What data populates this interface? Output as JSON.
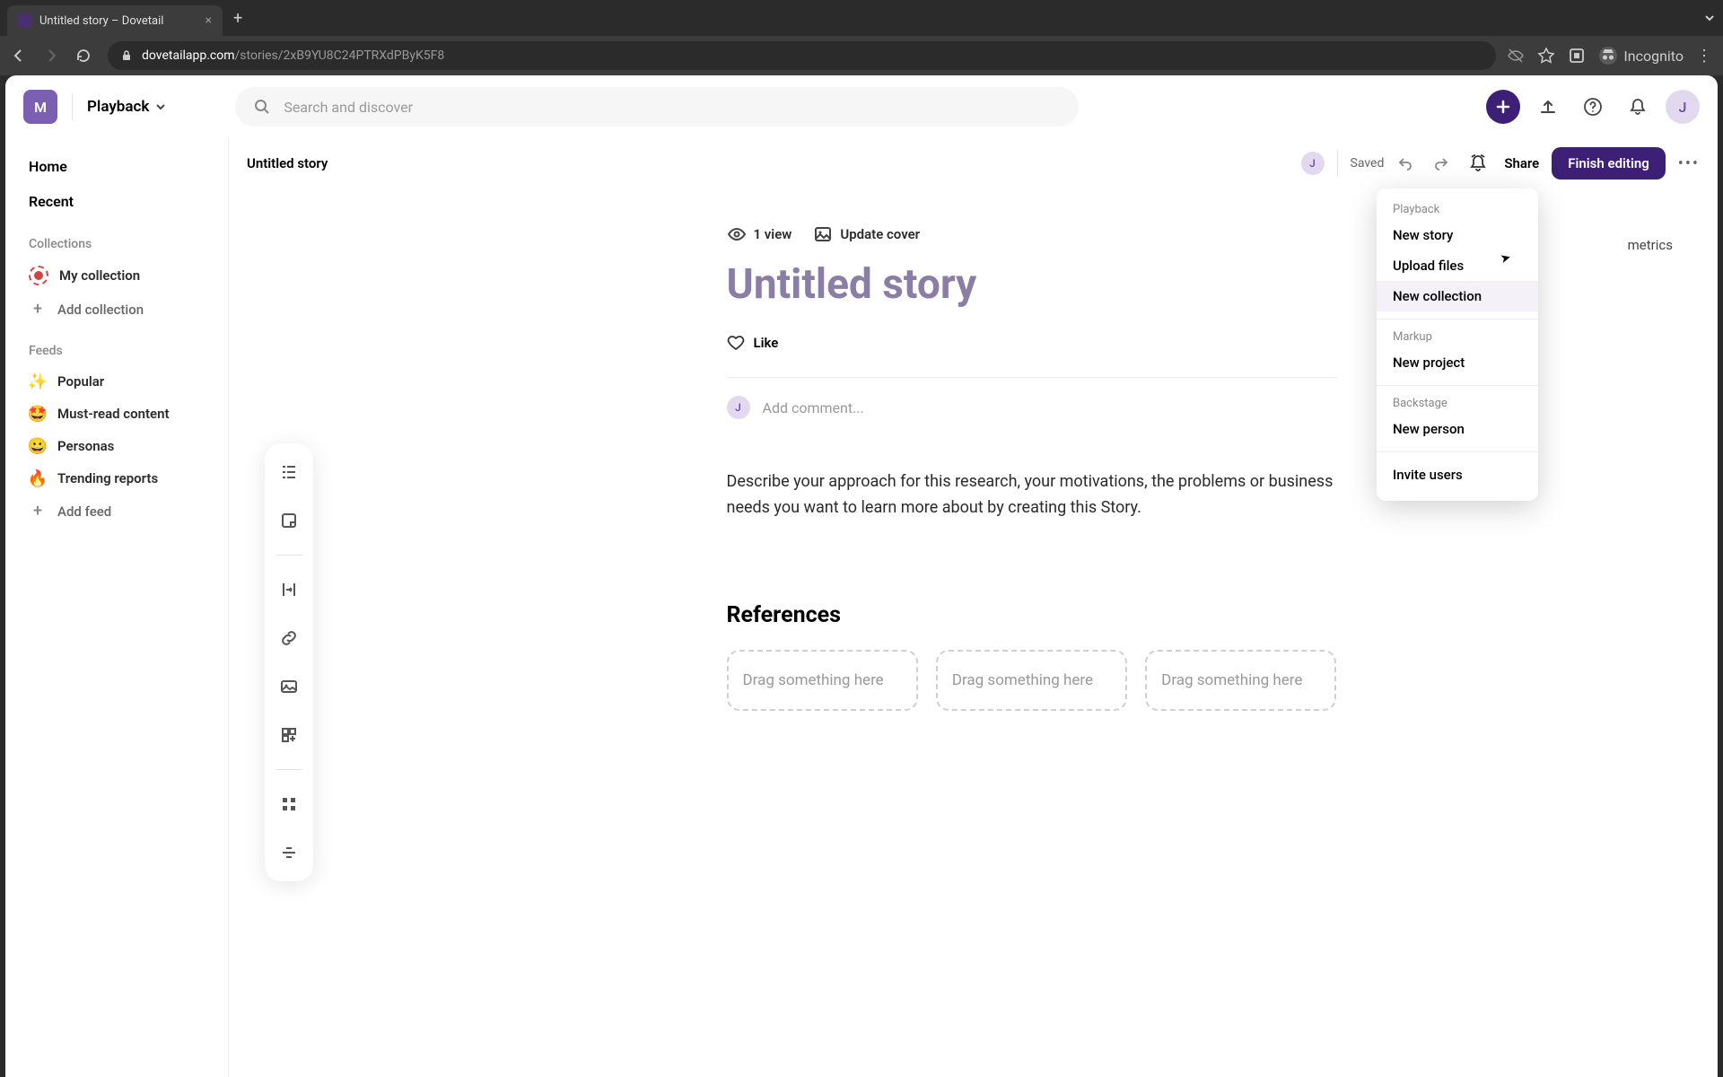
{
  "browser": {
    "tab_title": "Untitled story – Dovetail",
    "url_domain": "dovetailapp.com",
    "url_path": "/stories/2xB9YU8C24PTRXdPByK5F8",
    "incognito_label": "Incognito"
  },
  "topbar": {
    "workspace_letter": "M",
    "workspace_name": "Playback",
    "search_placeholder": "Search and discover",
    "avatar_letter": "J"
  },
  "sidebar": {
    "nav": {
      "home": "Home",
      "recent": "Recent"
    },
    "collections_label": "Collections",
    "collections": [
      {
        "label": "My collection"
      }
    ],
    "add_collection": "Add collection",
    "feeds_label": "Feeds",
    "feeds": [
      {
        "icon": "✨",
        "label": "Popular"
      },
      {
        "icon": "🤩",
        "label": "Must-read content"
      },
      {
        "icon": "😀",
        "label": "Personas"
      },
      {
        "icon": "🔥",
        "label": "Trending reports"
      }
    ],
    "add_feed": "Add feed"
  },
  "content": {
    "breadcrumb_title": "Untitled story",
    "saved_label": "Saved",
    "share_label": "Share",
    "finish_label": "Finish editing",
    "metrics_label": "metrics",
    "views": "1 view",
    "update_cover": "Update cover",
    "title": "Untitled story",
    "like_label": "Like",
    "comment_placeholder": "Add comment...",
    "description": "Describe your approach for this research, your motivations, the problems or business needs you want to learn more about by creating this Story.",
    "references_heading": "References",
    "dropzone_text": "Drag something here",
    "avatar_letter": "J"
  },
  "dropdown": {
    "sections": [
      {
        "label": "Playback",
        "items": [
          "New story",
          "Upload files",
          "New collection"
        ]
      },
      {
        "label": "Markup",
        "items": [
          "New project"
        ]
      },
      {
        "label": "Backstage",
        "items": [
          "New person"
        ]
      }
    ],
    "footer_item": "Invite users"
  }
}
